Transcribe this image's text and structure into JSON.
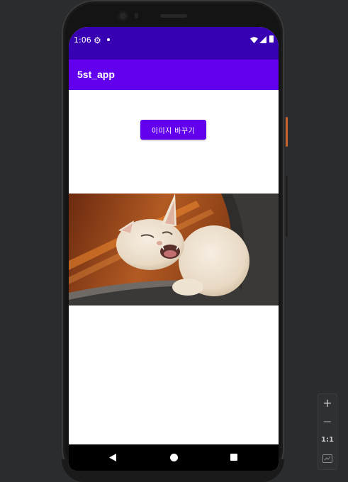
{
  "status_bar": {
    "time": "1:06",
    "icons": [
      "gear-icon",
      "notification-dot-icon",
      "wifi-icon",
      "signal-icon",
      "battery-icon"
    ]
  },
  "app_bar": {
    "title": "5st_app"
  },
  "main": {
    "change_image_button": "이미지 바꾸기",
    "image_subject": "laughing cat in armchair"
  },
  "nav_bar": {
    "icons": [
      "back-icon",
      "home-icon",
      "recents-icon"
    ]
  },
  "zoom_controls": {
    "zoom_in": "+",
    "zoom_out": "−",
    "actual_size": "1:1",
    "fit_icon": "fit-screen-icon"
  },
  "colors": {
    "status_bar": "#3700b3",
    "app_bar": "#6200ee",
    "button": "#6200ee",
    "background": "#ffffff"
  }
}
